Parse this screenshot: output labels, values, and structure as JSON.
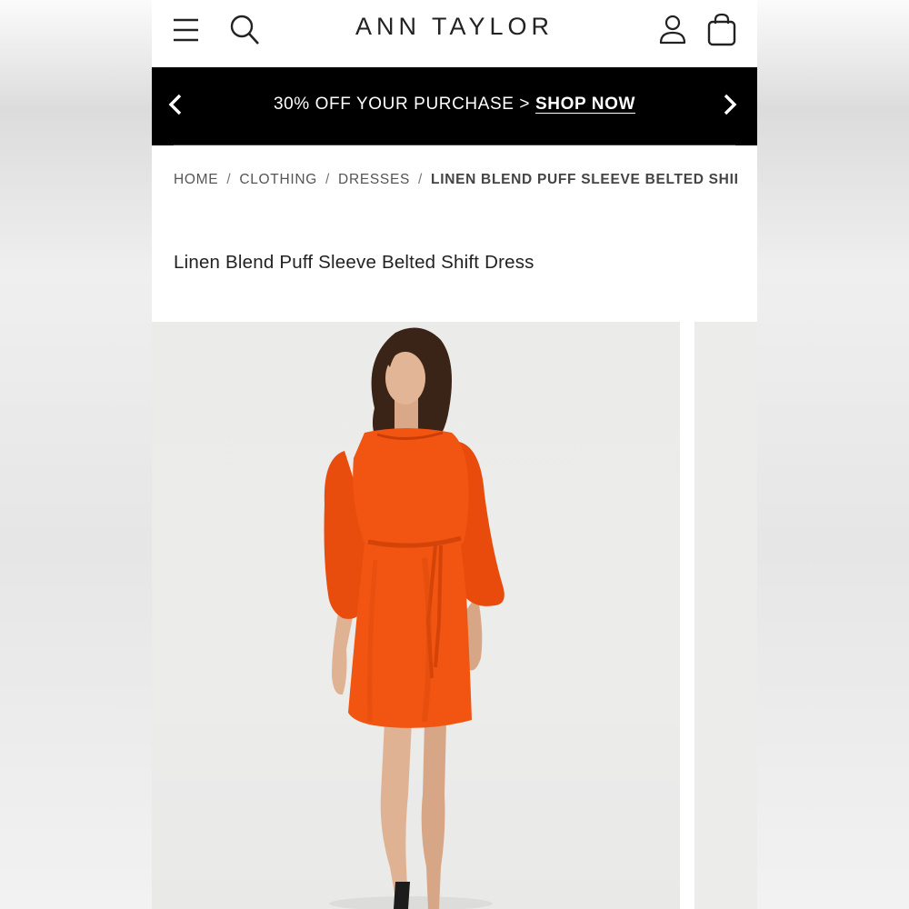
{
  "header": {
    "brand": "ANN TAYLOR",
    "icons": {
      "menu": "hamburger-menu-icon",
      "search": "search-icon",
      "account": "account-icon",
      "bag": "shopping-bag-icon"
    }
  },
  "promo": {
    "text": "30% OFF YOUR PURCHASE >",
    "link": "SHOP NOW",
    "background": "#000000"
  },
  "breadcrumb": {
    "items": [
      "HOME",
      "CLOTHING",
      "DRESSES"
    ],
    "current": "LINEN BLEND PUFF SLEEVE BELTED SHIFT ...",
    "separator": "/"
  },
  "product": {
    "title": "Linen Blend Puff Sleeve Belted Shift Dress",
    "dress_color": "#f25411"
  }
}
